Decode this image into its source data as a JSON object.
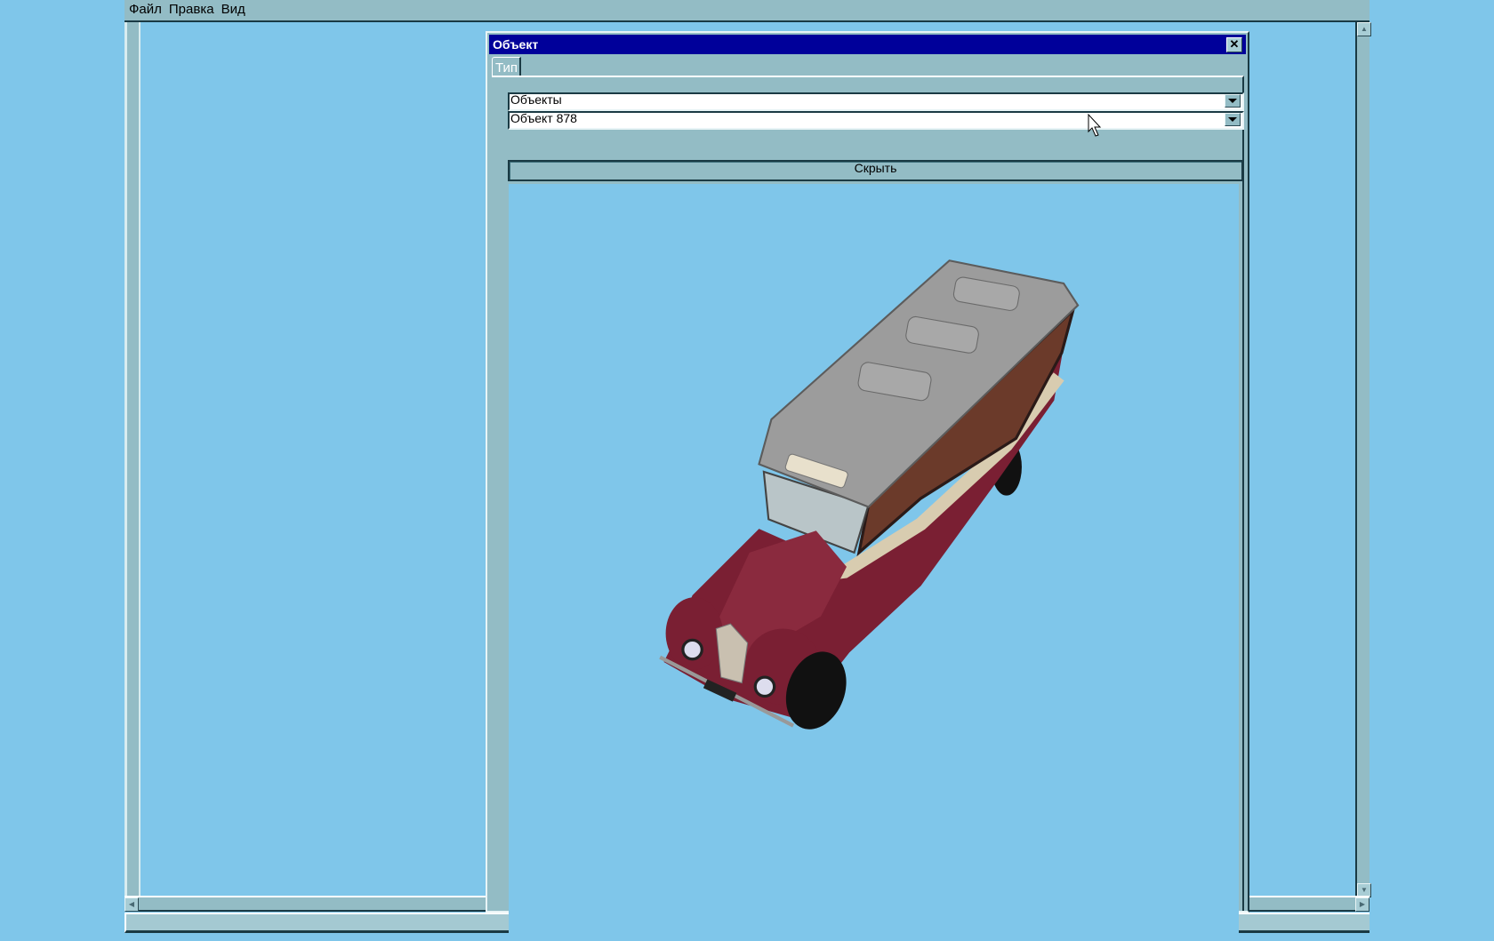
{
  "menubar": {
    "items": [
      "Файл",
      "Правка",
      "Вид"
    ]
  },
  "dialog": {
    "title": "Объект",
    "tabs": [
      {
        "label": "Тип",
        "active": true
      }
    ],
    "category_combo": {
      "value": "Объекты"
    },
    "object_combo": {
      "value": "Объект 878"
    },
    "hide_button_label": "Скрыть",
    "viewport": {
      "background": "#7fc6ea",
      "model": "bus"
    }
  },
  "colors": {
    "title_bar": "#00009a",
    "panel": "#93bcc5",
    "desktop": "#7fc6ea"
  }
}
